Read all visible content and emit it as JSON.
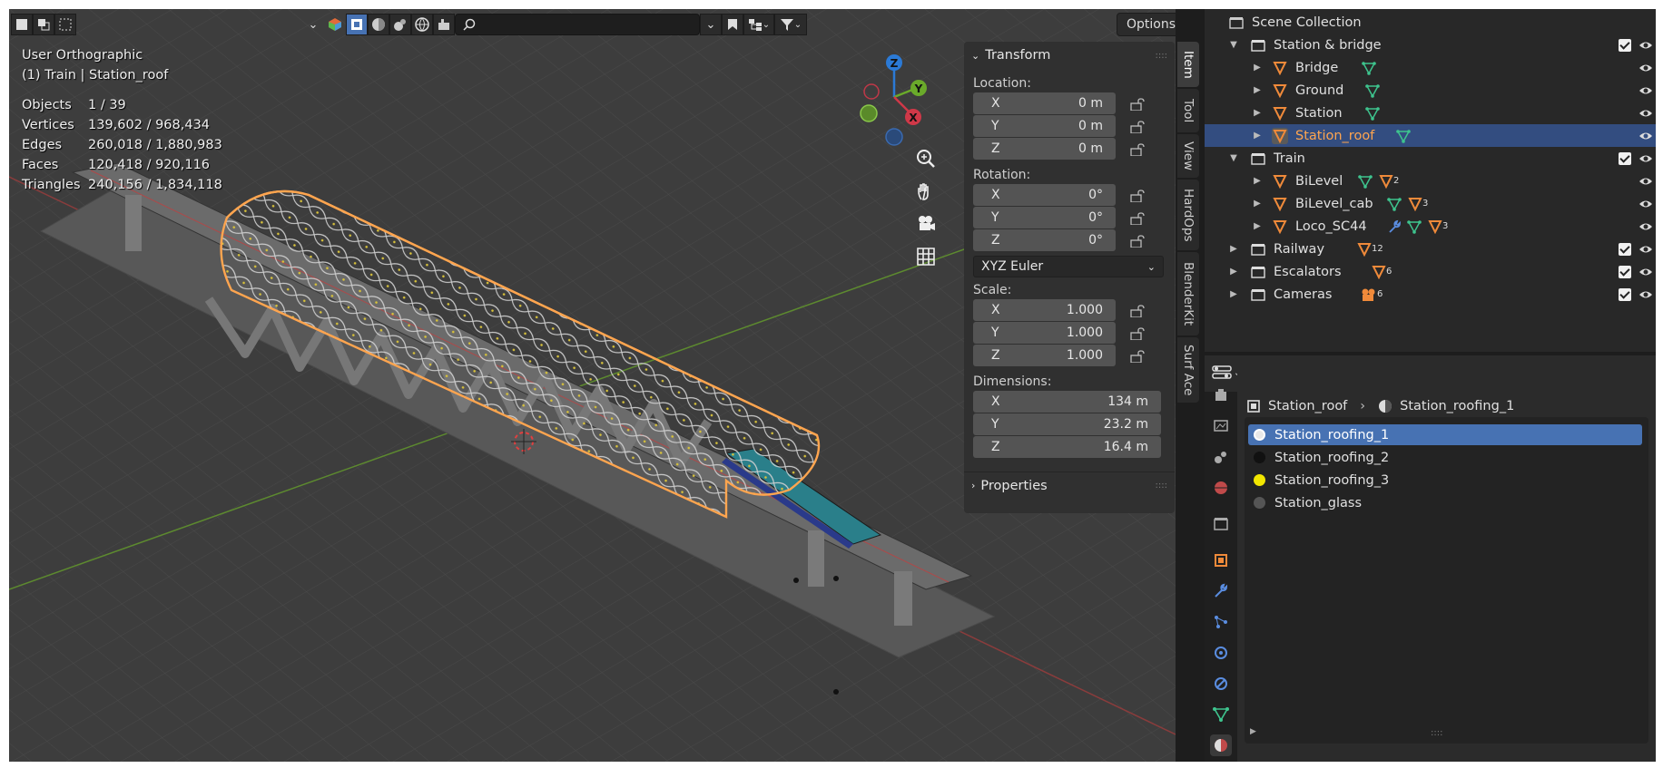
{
  "viewport": {
    "view_name": "User Orthographic",
    "active_label": "(1) Train | Station_roof",
    "stats": [
      {
        "label": "Objects",
        "value": "1 / 39"
      },
      {
        "label": "Vertices",
        "value": "139,602 / 968,434"
      },
      {
        "label": "Edges",
        "value": "260,018 / 1,880,983"
      },
      {
        "label": "Faces",
        "value": "120,418 / 920,116"
      },
      {
        "label": "Triangles",
        "value": "240,156 / 1,834,118"
      }
    ],
    "options_label": "Options",
    "gizmo_axes": {
      "x": "X",
      "y": "Y",
      "z": "Z"
    }
  },
  "npanel": {
    "transform_title": "Transform",
    "location_label": "Location:",
    "location": [
      {
        "axis": "X",
        "value": "0 m"
      },
      {
        "axis": "Y",
        "value": "0 m"
      },
      {
        "axis": "Z",
        "value": "0 m"
      }
    ],
    "rotation_label": "Rotation:",
    "rotation": [
      {
        "axis": "X",
        "value": "0°"
      },
      {
        "axis": "Y",
        "value": "0°"
      },
      {
        "axis": "Z",
        "value": "0°"
      }
    ],
    "rotation_mode": "XYZ Euler",
    "scale_label": "Scale:",
    "scale": [
      {
        "axis": "X",
        "value": "1.000"
      },
      {
        "axis": "Y",
        "value": "1.000"
      },
      {
        "axis": "Z",
        "value": "1.000"
      }
    ],
    "dimensions_label": "Dimensions:",
    "dimensions": [
      {
        "axis": "X",
        "value": "134 m"
      },
      {
        "axis": "Y",
        "value": "23.2 m"
      },
      {
        "axis": "Z",
        "value": "16.4 m"
      }
    ],
    "properties_title": "Properties"
  },
  "side_tabs": [
    "Item",
    "Tool",
    "View",
    "HardOps",
    "BlenderKit",
    "Surf Ace"
  ],
  "outliner": {
    "root": "Scene Collection",
    "rows": [
      {
        "name": "Station & bridge",
        "type": "collection",
        "depth": 1,
        "expanded": true
      },
      {
        "name": "Bridge",
        "type": "object",
        "depth": 2
      },
      {
        "name": "Ground",
        "type": "object",
        "depth": 2
      },
      {
        "name": "Station",
        "type": "object",
        "depth": 2
      },
      {
        "name": "Station_roof",
        "type": "object",
        "depth": 2,
        "selected": true
      },
      {
        "name": "Train",
        "type": "collection",
        "depth": 1,
        "expanded": true
      },
      {
        "name": "BiLevel",
        "type": "object",
        "depth": 2,
        "badge": "2"
      },
      {
        "name": "BiLevel_cab",
        "type": "object",
        "depth": 2,
        "badge": "3"
      },
      {
        "name": "Loco_SC44",
        "type": "object",
        "depth": 2,
        "badge": "3"
      },
      {
        "name": "Railway",
        "type": "collection",
        "depth": 1,
        "badge": "12"
      },
      {
        "name": "Escalators",
        "type": "collection",
        "depth": 1,
        "badge": "6"
      },
      {
        "name": "Cameras",
        "type": "collection",
        "depth": 1,
        "badge": "6"
      }
    ]
  },
  "properties": {
    "breadcrumb_object": "Station_roof",
    "breadcrumb_material": "Station_roofing_1",
    "materials": [
      {
        "name": "Station_roofing_1",
        "color": "#e8e8e8",
        "selected": true
      },
      {
        "name": "Station_roofing_2",
        "color": "#111111"
      },
      {
        "name": "Station_roofing_3",
        "color": "#f2e600"
      },
      {
        "name": "Station_glass",
        "color": "#555555"
      }
    ]
  },
  "colors": {
    "selection_orange": "#ffa54f",
    "active_blue": "#4772b3",
    "viewport_bg": "#3d3d3d"
  }
}
